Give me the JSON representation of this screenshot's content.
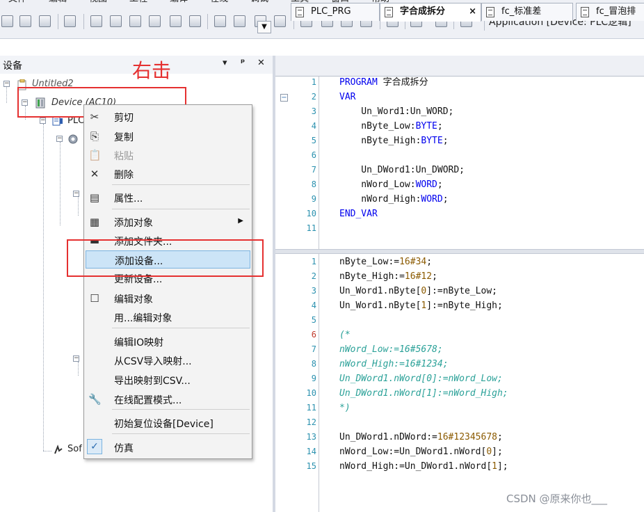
{
  "menubar": {
    "items": [
      "文件",
      "编辑",
      "视图",
      "工程",
      "编译",
      "在线",
      "调试",
      "工具",
      "窗口",
      "帮助"
    ]
  },
  "toolbar": {
    "application_label": "Application [Device: PLC逻辑]"
  },
  "device_pane": {
    "title": "设备",
    "pin_glyph": "▾",
    "dock_glyph": "ᵖ",
    "close_glyph": "✕",
    "tree": {
      "project": "Untitled2",
      "device": "Device (AC10)",
      "plc": "PLC",
      "softmotion": "Sof"
    }
  },
  "annotation": {
    "text": "右击"
  },
  "context_menu": {
    "items": [
      {
        "label": "剪切",
        "icon": "scissors-icon"
      },
      {
        "label": "复制",
        "icon": "copy-icon"
      },
      {
        "label": "粘贴",
        "icon": "paste-icon",
        "disabled": true
      },
      {
        "label": "删除",
        "icon": "delete-icon"
      },
      {
        "label": "属性...",
        "icon": "properties-icon"
      },
      {
        "label": "添加对象",
        "icon": "add-object-icon",
        "submenu": true
      },
      {
        "label": "添加文件夹...",
        "icon": "folder-icon"
      },
      {
        "label": "添加设备...",
        "icon": "",
        "highlighted": true
      },
      {
        "label": "更新设备...",
        "icon": ""
      },
      {
        "label": "编辑对象",
        "icon": "edit-object-icon"
      },
      {
        "label": "用...编辑对象",
        "icon": ""
      },
      {
        "label": "编辑IO映射",
        "icon": ""
      },
      {
        "label": "从CSV导入映射...",
        "icon": ""
      },
      {
        "label": "导出映射到CSV...",
        "icon": ""
      },
      {
        "label": "在线配置模式...",
        "icon": "wrench-icon"
      },
      {
        "label": "初始复位设备[Device]",
        "icon": ""
      },
      {
        "label": "仿真",
        "icon": "checkmark-icon",
        "checked": true
      }
    ]
  },
  "tabs": [
    {
      "label": "PLC_PRG",
      "active": false
    },
    {
      "label": "字合成拆分",
      "active": true,
      "close": "×"
    },
    {
      "label": "fc_标准差",
      "active": false
    },
    {
      "label": "fc_冒泡排",
      "active": false
    }
  ],
  "declaration": {
    "lines": [
      {
        "n": "1",
        "parts": [
          [
            "kw",
            "PROGRAM"
          ],
          [
            "",
            " 字合成拆分"
          ]
        ]
      },
      {
        "n": "2",
        "parts": [
          [
            "kw",
            "VAR"
          ]
        ]
      },
      {
        "n": "3",
        "parts": [
          [
            "",
            "    Un_Word1:Un_WORD;"
          ]
        ]
      },
      {
        "n": "4",
        "parts": [
          [
            "",
            "    nByte_Low:"
          ],
          [
            "kw",
            "BYTE"
          ],
          [
            "",
            ";"
          ]
        ]
      },
      {
        "n": "5",
        "parts": [
          [
            "",
            "    nByte_High:"
          ],
          [
            "kw",
            "BYTE"
          ],
          [
            "",
            ";"
          ]
        ]
      },
      {
        "n": "6",
        "parts": [
          [
            "",
            ""
          ]
        ]
      },
      {
        "n": "7",
        "parts": [
          [
            "",
            "    Un_DWord1:Un_DWORD;"
          ]
        ]
      },
      {
        "n": "8",
        "parts": [
          [
            "",
            "    nWord_Low:"
          ],
          [
            "kw",
            "WORD"
          ],
          [
            "",
            ";"
          ]
        ]
      },
      {
        "n": "9",
        "parts": [
          [
            "",
            "    nWord_High:"
          ],
          [
            "kw",
            "WORD"
          ],
          [
            "",
            ";"
          ]
        ]
      },
      {
        "n": "10",
        "parts": [
          [
            "kw",
            "END_VAR"
          ]
        ]
      },
      {
        "n": "11",
        "parts": [
          [
            "",
            ""
          ]
        ]
      }
    ]
  },
  "implementation": {
    "lines": [
      {
        "n": "1",
        "parts": [
          [
            "",
            "nByte_Low:="
          ],
          [
            "num",
            "16#34"
          ],
          [
            "",
            ";"
          ]
        ]
      },
      {
        "n": "2",
        "parts": [
          [
            "",
            "nByte_High:="
          ],
          [
            "num",
            "16#12"
          ],
          [
            "",
            ";"
          ]
        ]
      },
      {
        "n": "3",
        "parts": [
          [
            "",
            "Un_Word1.nByte["
          ],
          [
            "num",
            "0"
          ],
          [
            "",
            "]:=nByte_Low;"
          ]
        ]
      },
      {
        "n": "4",
        "parts": [
          [
            "",
            "Un_Word1.nByte["
          ],
          [
            "num",
            "1"
          ],
          [
            "",
            "]:=nByte_High;"
          ]
        ]
      },
      {
        "n": "5",
        "parts": [
          [
            "",
            ""
          ]
        ]
      },
      {
        "n": "6",
        "red": true,
        "parts": [
          [
            "cmt",
            "(*"
          ]
        ]
      },
      {
        "n": "7",
        "parts": [
          [
            "cmt",
            "nWord_Low:=16#5678;"
          ]
        ]
      },
      {
        "n": "8",
        "parts": [
          [
            "cmt",
            "nWord_High:=16#1234;"
          ]
        ]
      },
      {
        "n": "9",
        "parts": [
          [
            "cmt",
            "Un_DWord1.nWord[0]:=nWord_Low;"
          ]
        ]
      },
      {
        "n": "10",
        "parts": [
          [
            "cmt",
            "Un_DWord1.nWord[1]:=nWord_High;"
          ]
        ]
      },
      {
        "n": "11",
        "parts": [
          [
            "cmt",
            "*)"
          ]
        ]
      },
      {
        "n": "12",
        "parts": [
          [
            "",
            ""
          ]
        ]
      },
      {
        "n": "13",
        "parts": [
          [
            "",
            "Un_DWord1.nDWord:="
          ],
          [
            "num",
            "16#12345678"
          ],
          [
            "",
            ";"
          ]
        ]
      },
      {
        "n": "14",
        "parts": [
          [
            "",
            "nWord_Low:=Un_DWord1.nWord["
          ],
          [
            "num",
            "0"
          ],
          [
            "",
            "];"
          ]
        ]
      },
      {
        "n": "15",
        "parts": [
          [
            "",
            "nWord_High:=Un_DWord1.nWord["
          ],
          [
            "num",
            "1"
          ],
          [
            "",
            "];"
          ]
        ]
      }
    ]
  },
  "watermark": "CSDN @原来你也___",
  "colors": {
    "annotation_red": "#e53030",
    "keyword_blue": "#0000ee",
    "comment_teal": "#2aa198",
    "highlight": "#cce4f7"
  }
}
